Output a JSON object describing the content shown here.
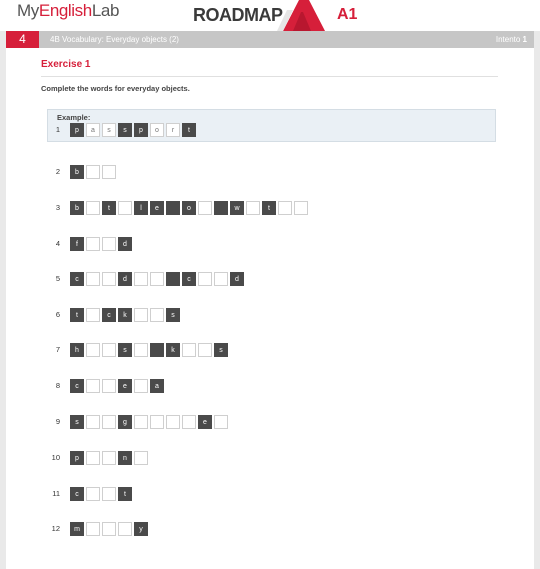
{
  "header": {
    "logo_my": "My",
    "logo_english": "English",
    "logo_lab": "Lab",
    "product": "ROADMAP",
    "level": "A1"
  },
  "bar": {
    "unit": "4",
    "breadcrumb": "4B Vocabulary: Everyday objects (2)",
    "attempt_label": "Intento",
    "attempt_value": "1"
  },
  "exercise": {
    "title": "Exercise 1",
    "instruction": "Complete the words for everyday objects.",
    "example_label": "Example:"
  },
  "example_row": {
    "num": "1",
    "cells": [
      {
        "t": "p",
        "s": "dark"
      },
      {
        "t": "a",
        "s": "light"
      },
      {
        "t": "s",
        "s": "light"
      },
      {
        "t": "s",
        "s": "dark"
      },
      {
        "t": "p",
        "s": "dark"
      },
      {
        "t": "o",
        "s": "light"
      },
      {
        "t": "r",
        "s": "light"
      },
      {
        "t": "t",
        "s": "dark"
      }
    ]
  },
  "rows": [
    {
      "num": "2",
      "cells": [
        {
          "t": "b",
          "s": "dark"
        },
        {
          "t": "",
          "s": "blank"
        },
        {
          "t": "",
          "s": "blank"
        }
      ]
    },
    {
      "num": "3",
      "cells": [
        {
          "t": "b",
          "s": "dark"
        },
        {
          "t": "",
          "s": "blank"
        },
        {
          "t": "t",
          "s": "dark"
        },
        {
          "t": "",
          "s": "blank"
        },
        {
          "t": "l",
          "s": "dark"
        },
        {
          "t": "e",
          "s": "dark"
        },
        {
          "t": "",
          "s": "dark"
        },
        {
          "t": "o",
          "s": "dark"
        },
        {
          "t": "",
          "s": "blank"
        },
        {
          "t": "",
          "s": "dark"
        },
        {
          "t": "w",
          "s": "dark"
        },
        {
          "t": "",
          "s": "blank"
        },
        {
          "t": "t",
          "s": "dark"
        },
        {
          "t": "",
          "s": "blank"
        },
        {
          "t": "",
          "s": "blank"
        }
      ]
    },
    {
      "num": "4",
      "cells": [
        {
          "t": "f",
          "s": "dark"
        },
        {
          "t": "",
          "s": "blank"
        },
        {
          "t": "",
          "s": "blank"
        },
        {
          "t": "d",
          "s": "dark"
        }
      ]
    },
    {
      "num": "5",
      "cells": [
        {
          "t": "c",
          "s": "dark"
        },
        {
          "t": "",
          "s": "blank"
        },
        {
          "t": "",
          "s": "blank"
        },
        {
          "t": "d",
          "s": "dark"
        },
        {
          "t": "",
          "s": "blank"
        },
        {
          "t": "",
          "s": "blank"
        },
        {
          "t": "",
          "s": "dark"
        },
        {
          "t": "c",
          "s": "dark"
        },
        {
          "t": "",
          "s": "blank"
        },
        {
          "t": "",
          "s": "blank"
        },
        {
          "t": "d",
          "s": "dark"
        }
      ]
    },
    {
      "num": "6",
      "cells": [
        {
          "t": "t",
          "s": "dark"
        },
        {
          "t": "",
          "s": "blank"
        },
        {
          "t": "c",
          "s": "dark"
        },
        {
          "t": "k",
          "s": "dark"
        },
        {
          "t": "",
          "s": "blank"
        },
        {
          "t": "",
          "s": "blank"
        },
        {
          "t": "s",
          "s": "dark"
        }
      ]
    },
    {
      "num": "7",
      "cells": [
        {
          "t": "h",
          "s": "dark"
        },
        {
          "t": "",
          "s": "blank"
        },
        {
          "t": "",
          "s": "blank"
        },
        {
          "t": "s",
          "s": "dark"
        },
        {
          "t": "",
          "s": "blank"
        },
        {
          "t": "",
          "s": "dark"
        },
        {
          "t": "k",
          "s": "dark"
        },
        {
          "t": "",
          "s": "blank"
        },
        {
          "t": "",
          "s": "blank"
        },
        {
          "t": "s",
          "s": "dark"
        }
      ]
    },
    {
      "num": "8",
      "cells": [
        {
          "t": "c",
          "s": "dark"
        },
        {
          "t": "",
          "s": "blank"
        },
        {
          "t": "",
          "s": "blank"
        },
        {
          "t": "e",
          "s": "dark"
        },
        {
          "t": "",
          "s": "blank"
        },
        {
          "t": "a",
          "s": "dark"
        }
      ]
    },
    {
      "num": "9",
      "cells": [
        {
          "t": "s",
          "s": "dark"
        },
        {
          "t": "",
          "s": "blank"
        },
        {
          "t": "",
          "s": "blank"
        },
        {
          "t": "g",
          "s": "dark"
        },
        {
          "t": "",
          "s": "blank"
        },
        {
          "t": "",
          "s": "blank"
        },
        {
          "t": "",
          "s": "blank"
        },
        {
          "t": "",
          "s": "blank"
        },
        {
          "t": "e",
          "s": "dark"
        },
        {
          "t": "",
          "s": "blank"
        }
      ]
    },
    {
      "num": "10",
      "cells": [
        {
          "t": "p",
          "s": "dark"
        },
        {
          "t": "",
          "s": "blank"
        },
        {
          "t": "",
          "s": "blank"
        },
        {
          "t": "n",
          "s": "dark"
        },
        {
          "t": "",
          "s": "blank"
        }
      ]
    },
    {
      "num": "11",
      "cells": [
        {
          "t": "c",
          "s": "dark"
        },
        {
          "t": "",
          "s": "blank"
        },
        {
          "t": "",
          "s": "blank"
        },
        {
          "t": "t",
          "s": "dark"
        }
      ]
    },
    {
      "num": "12",
      "cells": [
        {
          "t": "m",
          "s": "dark"
        },
        {
          "t": "",
          "s": "blank"
        },
        {
          "t": "",
          "s": "blank"
        },
        {
          "t": "",
          "s": "blank"
        },
        {
          "t": "y",
          "s": "dark"
        }
      ]
    }
  ],
  "colors": {
    "brand_red": "#d61f3a",
    "bar_grey": "#c6c6c6",
    "cell_dark": "#4a4a4a",
    "example_bg": "#eaf0f5"
  }
}
